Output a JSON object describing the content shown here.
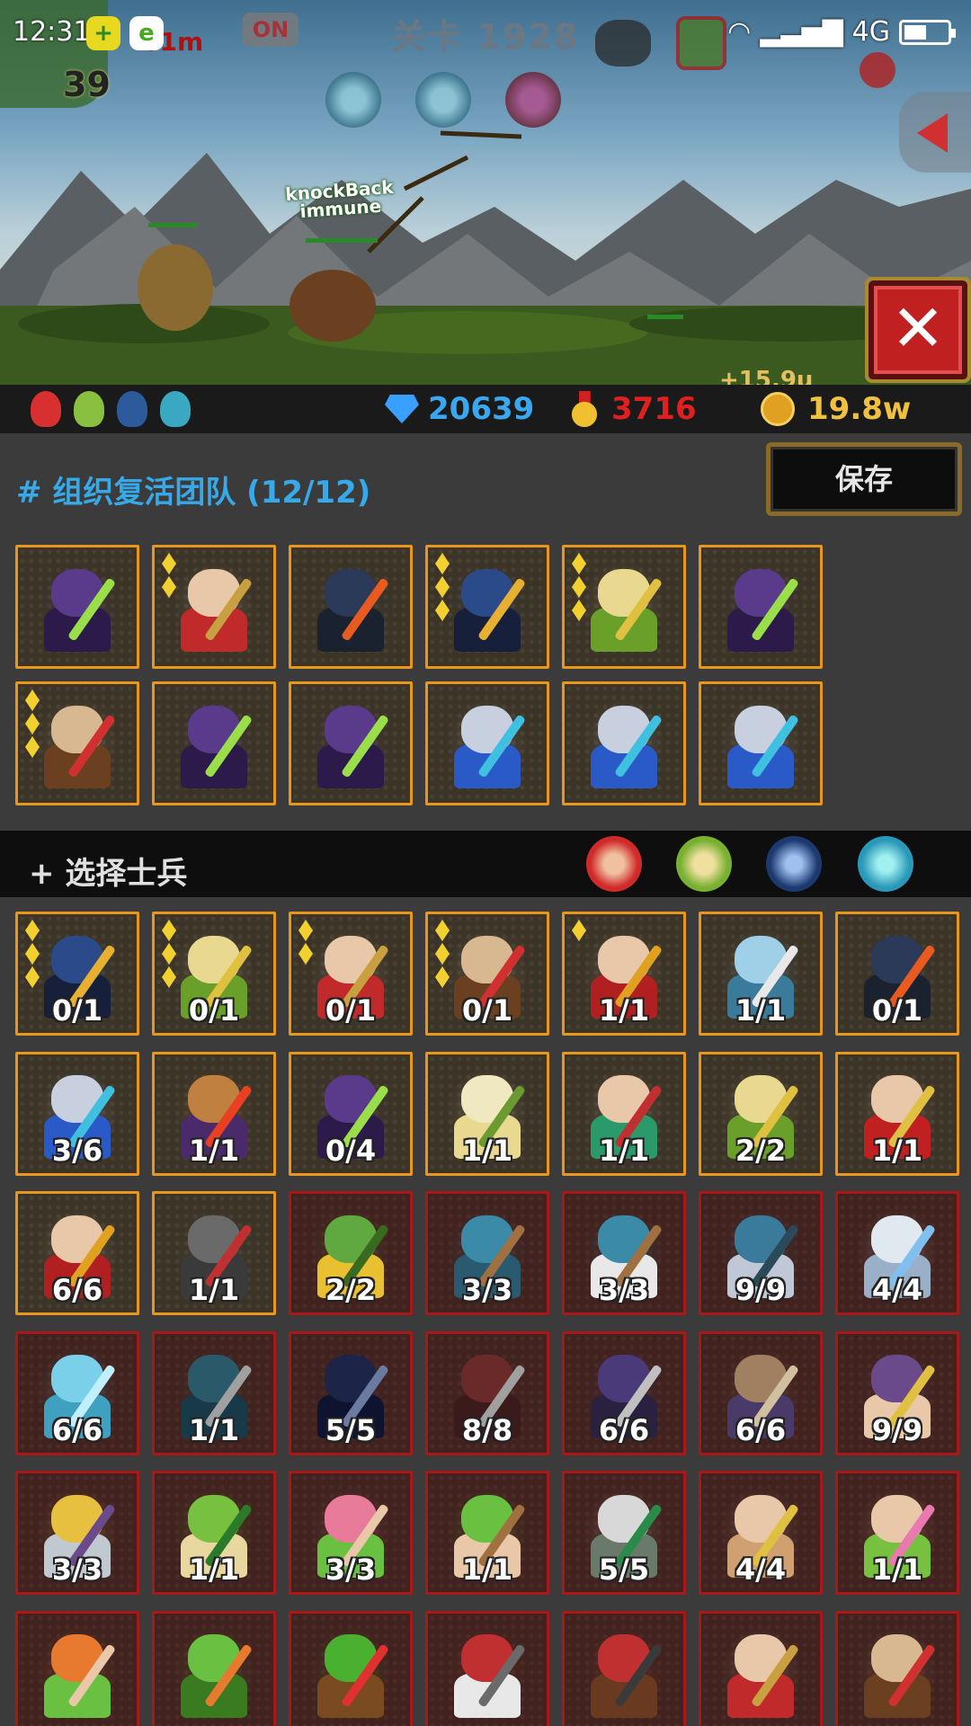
{
  "status_bar": {
    "time": "12:31",
    "network": "4G"
  },
  "hud": {
    "level_title": "关卡 1928",
    "timer": "01m",
    "toggle_label": "ON",
    "shield_value": "39",
    "knockback_text": "knockBack\nimmune",
    "coin_gain": "+15.9u"
  },
  "resources": {
    "gems": "20639",
    "medals": "3716",
    "gold": "19.8w"
  },
  "team": {
    "title": "# 组织复活团队 (12/12)",
    "save_label": "保存",
    "members": [
      {
        "unit": "purple-archer",
        "stars": 0
      },
      {
        "unit": "king-mage",
        "stars": 2
      },
      {
        "unit": "dark-knight",
        "stars": 0
      },
      {
        "unit": "samurai",
        "stars": 3
      },
      {
        "unit": "valkyrie",
        "stars": 3
      },
      {
        "unit": "purple-archer",
        "stars": 0
      },
      {
        "unit": "griffin-rider",
        "stars": 3
      },
      {
        "unit": "purple-archer",
        "stars": 0
      },
      {
        "unit": "purple-archer",
        "stars": 0
      },
      {
        "unit": "blue-knight",
        "stars": 0
      },
      {
        "unit": "blue-knight",
        "stars": 0
      },
      {
        "unit": "blue-knight",
        "stars": 0
      }
    ]
  },
  "select": {
    "title": "+ 选择士兵",
    "filters": [
      "red-warrior-filter-icon",
      "green-elf-filter-icon",
      "blue-knight-filter-icon",
      "cyan-beast-filter-icon"
    ],
    "soldiers": [
      {
        "unit": "samurai",
        "count": "0/1",
        "stars": 3,
        "locked": false
      },
      {
        "unit": "valkyrie",
        "count": "0/1",
        "stars": 3,
        "locked": false
      },
      {
        "unit": "king-mage",
        "count": "0/1",
        "stars": 2,
        "locked": false
      },
      {
        "unit": "griffin-rider",
        "count": "0/1",
        "stars": 3,
        "locked": false
      },
      {
        "unit": "red-priest",
        "count": "1/1",
        "stars": 1,
        "locked": false
      },
      {
        "unit": "ice-dragon",
        "count": "1/1",
        "stars": 0,
        "locked": false
      },
      {
        "unit": "dark-knight",
        "count": "0/1",
        "stars": 0,
        "locked": false
      },
      {
        "unit": "blue-knight",
        "count": "3/6",
        "stars": 0,
        "locked": false
      },
      {
        "unit": "warlord",
        "count": "1/1",
        "stars": 0,
        "locked": false
      },
      {
        "unit": "purple-archer",
        "count": "0/4",
        "stars": 0,
        "locked": false
      },
      {
        "unit": "forest-queen",
        "count": "1/1",
        "stars": 0,
        "locked": false
      },
      {
        "unit": "jade-warrior",
        "count": "1/1",
        "stars": 0,
        "locked": false
      },
      {
        "unit": "valkyrie",
        "count": "2/2",
        "stars": 0,
        "locked": false
      },
      {
        "unit": "cardinal",
        "count": "1/1",
        "stars": 0,
        "locked": false
      },
      {
        "unit": "red-priest",
        "count": "6/6",
        "stars": 0,
        "locked": false
      },
      {
        "unit": "stone-golem",
        "count": "1/1",
        "stars": 0,
        "locked": false
      },
      {
        "unit": "goblin",
        "count": "2/2",
        "stars": 0,
        "locked": true
      },
      {
        "unit": "lizard-spearman",
        "count": "3/3",
        "stars": 0,
        "locked": true
      },
      {
        "unit": "shaman",
        "count": "3/3",
        "stars": 0,
        "locked": true
      },
      {
        "unit": "wolf-rider",
        "count": "9/9",
        "stars": 0,
        "locked": true
      },
      {
        "unit": "frost-beast",
        "count": "4/4",
        "stars": 0,
        "locked": true
      },
      {
        "unit": "ice-troll",
        "count": "6/6",
        "stars": 0,
        "locked": true
      },
      {
        "unit": "naga",
        "count": "1/1",
        "stars": 0,
        "locked": true
      },
      {
        "unit": "dark-samurai",
        "count": "5/5",
        "stars": 0,
        "locked": true
      },
      {
        "unit": "werewolf",
        "count": "8/8",
        "stars": 0,
        "locked": true
      },
      {
        "unit": "assassin",
        "count": "6/6",
        "stars": 0,
        "locked": true
      },
      {
        "unit": "minotaur",
        "count": "6/6",
        "stars": 0,
        "locked": true
      },
      {
        "unit": "jester",
        "count": "9/9",
        "stars": 0,
        "locked": true
      },
      {
        "unit": "pharaoh",
        "count": "3/3",
        "stars": 0,
        "locked": true
      },
      {
        "unit": "harpy",
        "count": "1/1",
        "stars": 0,
        "locked": true
      },
      {
        "unit": "bunny-fighter",
        "count": "3/3",
        "stars": 0,
        "locked": true
      },
      {
        "unit": "elf-monk",
        "count": "1/1",
        "stars": 0,
        "locked": true
      },
      {
        "unit": "white-beast",
        "count": "5/5",
        "stars": 0,
        "locked": true
      },
      {
        "unit": "fox-spearman",
        "count": "4/4",
        "stars": 0,
        "locked": true
      },
      {
        "unit": "fairy",
        "count": "1/1",
        "stars": 0,
        "locked": true
      },
      {
        "unit": "fire-elf",
        "count": "",
        "stars": 0,
        "locked": true
      },
      {
        "unit": "toad",
        "count": "",
        "stars": 0,
        "locked": true
      },
      {
        "unit": "treant",
        "count": "",
        "stars": 0,
        "locked": true
      },
      {
        "unit": "dwarf",
        "count": "",
        "stars": 0,
        "locked": true
      },
      {
        "unit": "cannon-dwarf",
        "count": "",
        "stars": 0,
        "locked": true
      },
      {
        "unit": "king-mage",
        "count": "",
        "stars": 0,
        "locked": true
      },
      {
        "unit": "griffin-rider",
        "count": "",
        "stars": 0,
        "locked": true
      }
    ]
  },
  "colors": {
    "accent": "#38a9e8",
    "unlocked_border": "#e8961c",
    "locked_border": "#a81818",
    "medal_red": "#e02020"
  }
}
